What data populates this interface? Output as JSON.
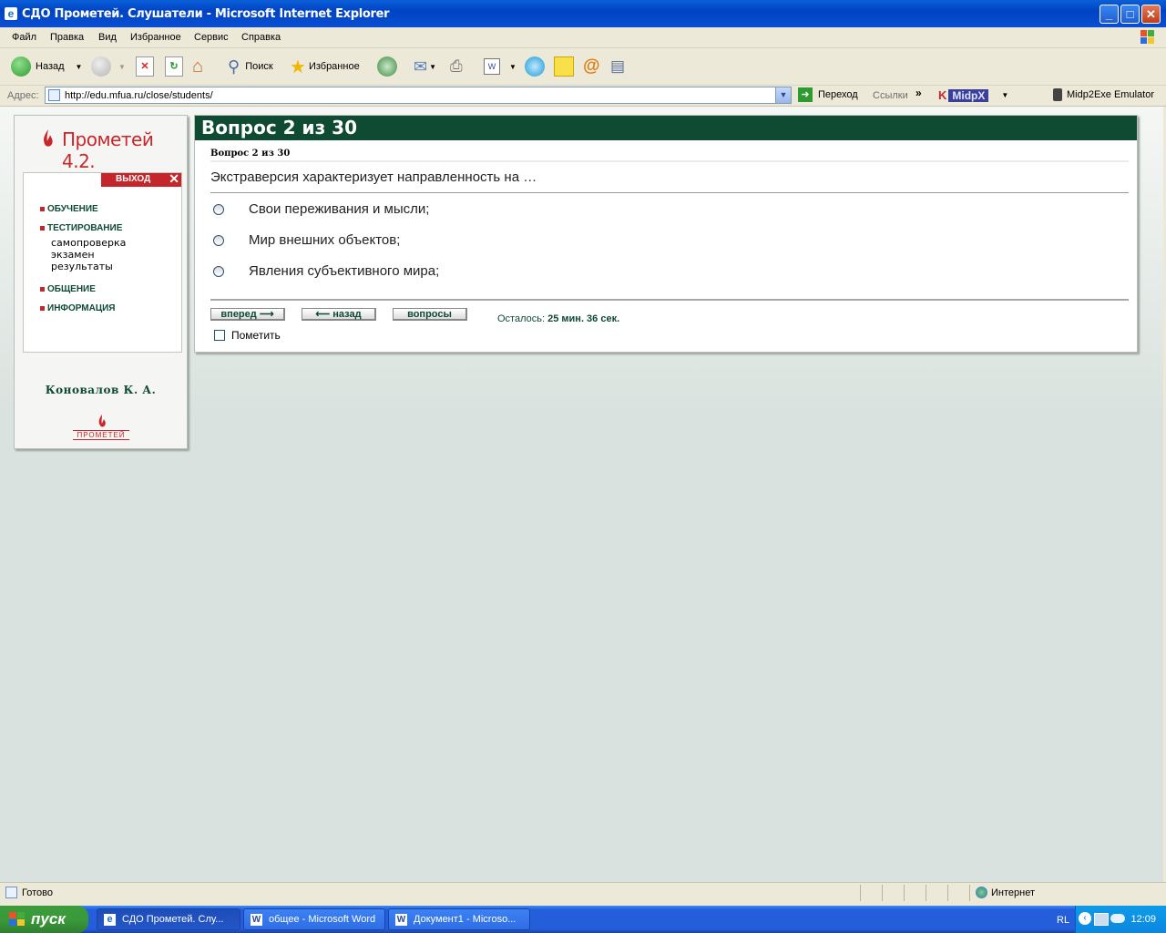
{
  "window": {
    "title": "СДО Прометей. Слушатели - Microsoft Internet Explorer"
  },
  "menu": [
    "Файл",
    "Правка",
    "Вид",
    "Избранное",
    "Сервис",
    "Справка"
  ],
  "toolbar": {
    "back": "Назад",
    "search": "Поиск",
    "favorites": "Избранное"
  },
  "address": {
    "label": "Адрес:",
    "url": "http://edu.mfua.ru/close/students/",
    "go": "Переход",
    "links": "Ссылки",
    "midpx": "MidpX",
    "emulator": "Midp2Exe Emulator"
  },
  "sidebar": {
    "logo": "Прометей 4.2.",
    "exit": "ВЫХОД",
    "sections": [
      "ОБУЧЕНИЕ",
      "ТЕСТИРОВАНИЕ",
      "ОБЩЕНИЕ",
      "ИНФОРМАЦИЯ"
    ],
    "testing_items": [
      "самопроверка",
      "экзамен",
      "результаты"
    ],
    "user": "Коновалов К. А.",
    "small_logo": "ПРОМЕТЕЙ"
  },
  "question": {
    "header": "Вопрос 2 из 30",
    "subheader": "Вопрос 2 из 30",
    "text": "Экстраверсия характеризует направленность на …",
    "options": [
      "Свои переживания и мысли;",
      "Мир внешних объектов;",
      "Явления субъективного мира;"
    ],
    "btn_forward": "вперед",
    "btn_back": "назад",
    "btn_questions": "вопросы",
    "remaining_label": "Осталось:",
    "remaining_value": "25 мин. 36 сек.",
    "mark_label": "Пометить"
  },
  "status": {
    "left": "Готово",
    "zone": "Интернет"
  },
  "taskbar": {
    "start": "пуск",
    "items": [
      "СДО Прометей. Слу...",
      "общее - Microsoft Word",
      "Документ1 - Microso..."
    ],
    "lang": "RL",
    "clock": "12:09"
  },
  "colors": {
    "accent_green": "#0f4a33",
    "accent_red": "#c4262c",
    "xp_blue": "#245edb"
  }
}
